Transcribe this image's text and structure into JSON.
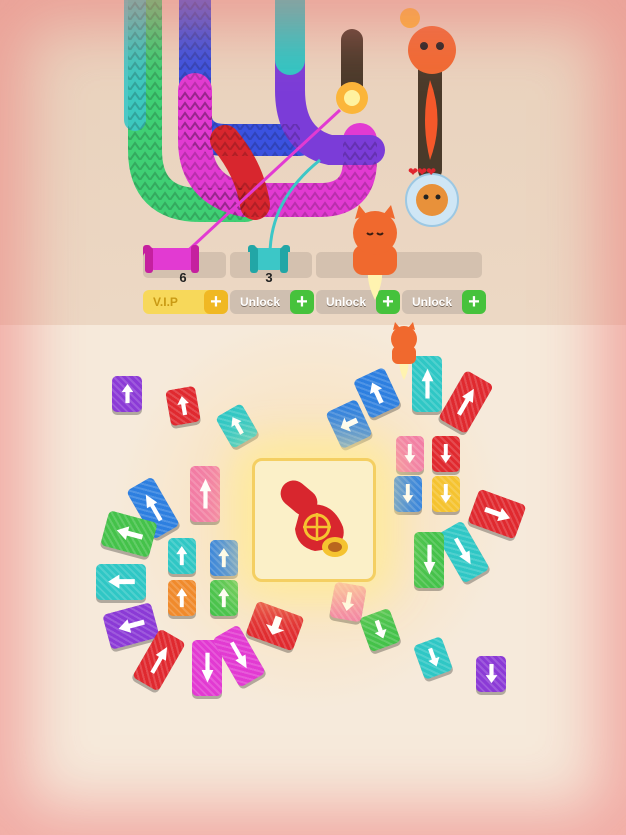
{
  "slots": {
    "counts": [
      "6",
      "3"
    ],
    "pills": [
      {
        "label": "V.I.P",
        "type": "vip"
      },
      {
        "label": "Unlock",
        "type": "lock"
      },
      {
        "label": "Unlock",
        "type": "lock"
      },
      {
        "label": "Unlock",
        "type": "lock"
      }
    ]
  },
  "colors": {
    "red": "#e0292f",
    "green": "#44c24a",
    "blue": "#2d7fe0",
    "teal": "#2fc7c5",
    "purple": "#8b3ad6",
    "magenta": "#e23ad2",
    "pink": "#f27ca5",
    "orange": "#f08a2c",
    "yellow": "#f5c330",
    "plus_green": "#46c23c",
    "vip_gold": "#f7d85a"
  },
  "tiles": [
    {
      "color": "purple",
      "dir": "up"
    },
    {
      "color": "red",
      "dir": "up"
    },
    {
      "color": "teal",
      "dir": "up"
    },
    {
      "color": "blue",
      "dir": "up"
    },
    {
      "color": "teal",
      "dir": "up"
    },
    {
      "color": "red",
      "dir": "up"
    },
    {
      "color": "pink",
      "dir": "up"
    },
    {
      "color": "blue",
      "dir": "up"
    },
    {
      "color": "green",
      "dir": "left"
    },
    {
      "color": "teal",
      "dir": "left"
    },
    {
      "color": "purple",
      "dir": "left"
    },
    {
      "color": "teal",
      "dir": "up"
    },
    {
      "color": "blue",
      "dir": "up"
    },
    {
      "color": "orange",
      "dir": "up"
    },
    {
      "color": "green",
      "dir": "up"
    },
    {
      "color": "red",
      "dir": "up"
    },
    {
      "color": "magenta",
      "dir": "down"
    },
    {
      "color": "magenta",
      "dir": "down"
    },
    {
      "color": "red",
      "dir": "down"
    },
    {
      "color": "pink",
      "dir": "down"
    },
    {
      "color": "red",
      "dir": "down"
    },
    {
      "color": "blue",
      "dir": "down"
    },
    {
      "color": "yellow",
      "dir": "down"
    },
    {
      "color": "red",
      "dir": "right"
    },
    {
      "color": "teal",
      "dir": "down"
    },
    {
      "color": "green",
      "dir": "down"
    },
    {
      "color": "green",
      "dir": "down"
    },
    {
      "color": "teal",
      "dir": "down"
    },
    {
      "color": "purple",
      "dir": "down"
    },
    {
      "color": "blue",
      "dir": "left"
    },
    {
      "color": "pink",
      "dir": "down"
    }
  ],
  "hud": {
    "hearts": "❤❤❤"
  },
  "booster": {
    "icon": "pointer-glove-icon"
  }
}
